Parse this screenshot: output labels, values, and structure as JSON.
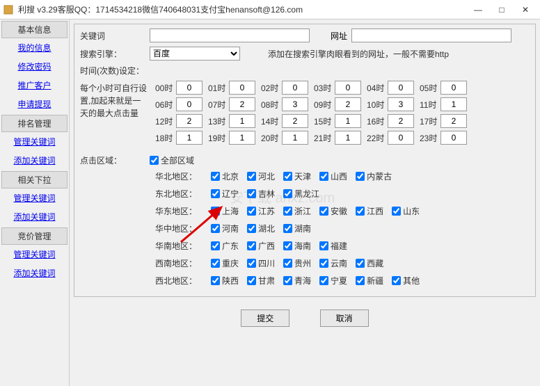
{
  "window": {
    "title": "利搜 v3.29客服QQ：1714534218微信740648031支付宝henansoft@126.com",
    "min": "—",
    "max": "□",
    "close": "✕"
  },
  "sidebar": {
    "groups": [
      {
        "header": "基本信息",
        "links": [
          "我的信息",
          "修改密码",
          "推广客户",
          "申请提现"
        ]
      },
      {
        "header": "排名管理",
        "links": [
          "管理关键词",
          "添加关键词"
        ]
      },
      {
        "header": "相关下拉",
        "links": [
          "管理关键词",
          "添加关键词"
        ]
      },
      {
        "header": "竞价管理",
        "links": [
          "管理关键词",
          "添加关键词"
        ]
      }
    ]
  },
  "form": {
    "keyword_label": "关键词",
    "keyword_value": "",
    "url_label": "网址",
    "url_value": "",
    "engine_label": "搜索引擎：",
    "engine_value": "百度",
    "engine_hint": "添加在搜索引擎肉眼看到的网址，一般不需要http",
    "time_label": "时间(次数)设定：",
    "time_desc": "每个小时可自行设置,加起来就是一天的最大点击量",
    "hours": [
      {
        "h": "00时",
        "v": "0"
      },
      {
        "h": "01时",
        "v": "0"
      },
      {
        "h": "02时",
        "v": "0"
      },
      {
        "h": "03时",
        "v": "0"
      },
      {
        "h": "04时",
        "v": "0"
      },
      {
        "h": "05时",
        "v": "0"
      },
      {
        "h": "06时",
        "v": "0"
      },
      {
        "h": "07时",
        "v": "2"
      },
      {
        "h": "08时",
        "v": "3"
      },
      {
        "h": "09时",
        "v": "2"
      },
      {
        "h": "10时",
        "v": "3"
      },
      {
        "h": "11时",
        "v": "1"
      },
      {
        "h": "12时",
        "v": "2"
      },
      {
        "h": "13时",
        "v": "1"
      },
      {
        "h": "14时",
        "v": "2"
      },
      {
        "h": "15时",
        "v": "1"
      },
      {
        "h": "16时",
        "v": "2"
      },
      {
        "h": "17时",
        "v": "2"
      },
      {
        "h": "18时",
        "v": "1"
      },
      {
        "h": "19时",
        "v": "1"
      },
      {
        "h": "20时",
        "v": "1"
      },
      {
        "h": "21时",
        "v": "1"
      },
      {
        "h": "22时",
        "v": "0"
      },
      {
        "h": "23时",
        "v": "0"
      }
    ],
    "region_label": "点击区域：",
    "all_region": "全部区域",
    "regions": [
      {
        "name": "华北地区：",
        "items": [
          "北京",
          "河北",
          "天津",
          "山西",
          "内蒙古"
        ]
      },
      {
        "name": "东北地区：",
        "items": [
          "辽宁",
          "吉林",
          "黑龙江"
        ]
      },
      {
        "name": "华东地区：",
        "items": [
          "上海",
          "江苏",
          "浙江",
          "安徽",
          "江西",
          "山东"
        ]
      },
      {
        "name": "华中地区：",
        "items": [
          "河南",
          "湖北",
          "湖南"
        ]
      },
      {
        "name": "华南地区：",
        "items": [
          "广东",
          "广西",
          "海南",
          "福建"
        ]
      },
      {
        "name": "西南地区：",
        "items": [
          "重庆",
          "四川",
          "贵州",
          "云南",
          "西藏"
        ]
      },
      {
        "name": "西北地区：",
        "items": [
          "陕西",
          "甘肃",
          "青海",
          "宁夏",
          "新疆",
          "其他"
        ]
      }
    ],
    "submit": "提交",
    "cancel": "取消"
  },
  "watermark": "安下载 anxz.com"
}
